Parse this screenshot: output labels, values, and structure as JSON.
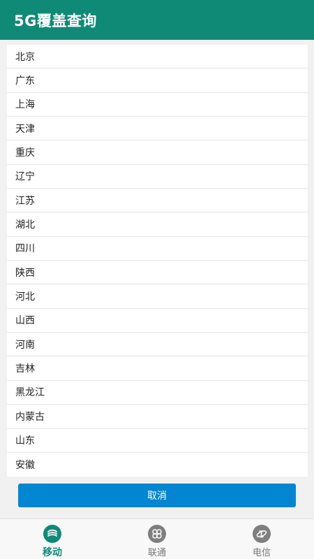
{
  "colors": {
    "primary": "#0f8a76",
    "accent": "#0286d1",
    "inactive": "#777777"
  },
  "header": {
    "title": "5G覆盖查询"
  },
  "provinces": [
    "北京",
    "广东",
    "上海",
    "天津",
    "重庆",
    "辽宁",
    "江苏",
    "湖北",
    "四川",
    "陕西",
    "河北",
    "山西",
    "河南",
    "吉林",
    "黑龙江",
    "内蒙古",
    "山东",
    "安徽"
  ],
  "actions": {
    "cancel_label": "取消"
  },
  "bottom_nav": {
    "tabs": [
      {
        "label": "移动",
        "icon": "china-mobile-icon",
        "active": true
      },
      {
        "label": "联通",
        "icon": "china-unicom-icon",
        "active": false
      },
      {
        "label": "电信",
        "icon": "china-telecom-icon",
        "active": false
      }
    ]
  }
}
